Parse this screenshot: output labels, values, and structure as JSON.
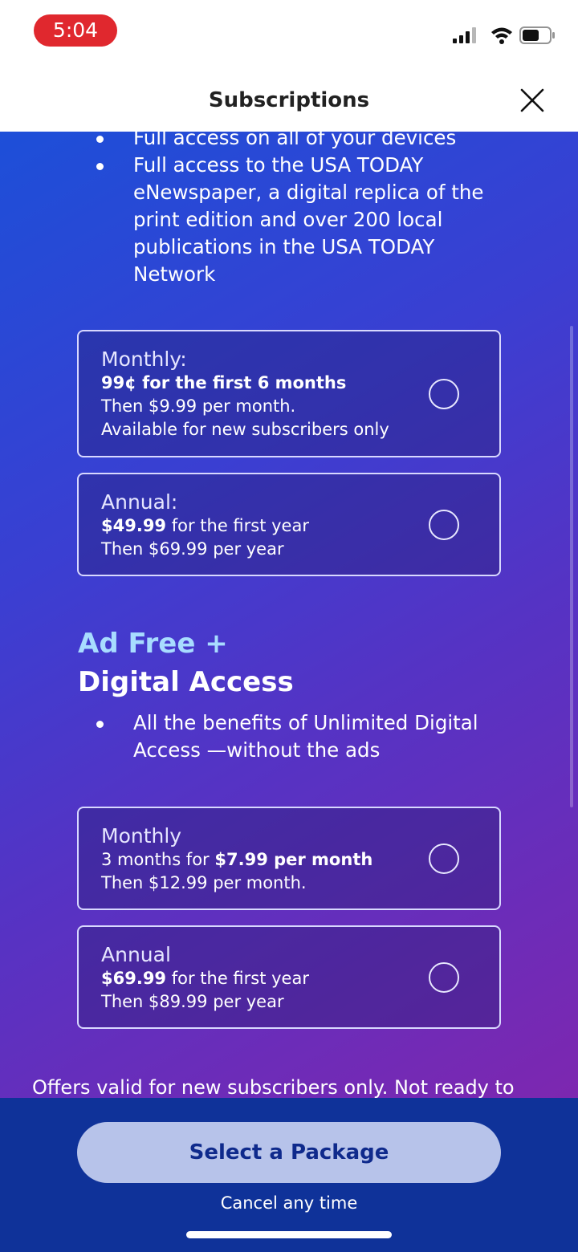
{
  "status_bar": {
    "time": "5:04",
    "icons": [
      "cellular-signal-icon",
      "wifi-icon",
      "battery-icon"
    ]
  },
  "header": {
    "title": "Subscriptions",
    "close_icon": "close-icon"
  },
  "digital_access": {
    "bullets": [
      "Full access on all of your devices",
      "Full access to the USA TODAY eNewspaper, a digital replica of the print edition and over 200 local publications in the USA TODAY Network"
    ],
    "plans": [
      {
        "title": "Monthly:",
        "line1_bold": "99¢ for the first 6 months",
        "line2": "Then $9.99 per month.",
        "line3": "Available for new subscribers only",
        "selected": false
      },
      {
        "title": "Annual:",
        "line1_bold": "$49.99",
        "line1_rest": " for the first year",
        "line2": "Then $69.99 per year",
        "selected": false
      }
    ]
  },
  "ad_free": {
    "heading_accent": "Ad Free +",
    "heading_main": "Digital Access",
    "bullets": [
      "All the benefits of Unlimited Digital Access —without the ads"
    ],
    "plans": [
      {
        "title": "Monthly",
        "line1_pre": "3 months for ",
        "line1_bold": "$7.99 per month",
        "line2": "Then $12.99 per month.",
        "selected": false
      },
      {
        "title": "Annual",
        "line1_bold": "$69.99",
        "line1_rest": " for the first year",
        "line2": "Then $89.99 per year",
        "selected": false
      }
    ]
  },
  "offers_text": "Offers valid for new subscribers only. Not ready to",
  "footer": {
    "select_button": "Select a Package",
    "cancel_text": "Cancel any time"
  },
  "colors": {
    "gradient_start": "#1d4fd8",
    "gradient_end": "#7d27b0",
    "footer_bg": "#0f3299",
    "button_bg": "#b7c3ea",
    "button_text": "#0f2a8c",
    "time_pill": "#e0282e",
    "heading_accent": "#a8dcff"
  }
}
